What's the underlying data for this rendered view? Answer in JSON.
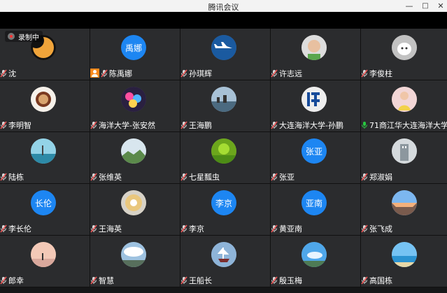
{
  "window": {
    "title": "腾讯会议",
    "minimize": "—",
    "maximize": "□",
    "close": "✕"
  },
  "recording": {
    "label": "录制中"
  },
  "participants": [
    {
      "name": "沈",
      "avatar_type": "image",
      "avatar_desc": "orange-moon",
      "mic": "muted"
    },
    {
      "name": "陈禹娜",
      "avatar_type": "text",
      "avatar_text": "禹娜",
      "mic": "muted",
      "role_icon": "host-person-icon"
    },
    {
      "name": "孙琪辉",
      "avatar_type": "image",
      "avatar_desc": "airplane",
      "mic": "muted"
    },
    {
      "name": "许志远",
      "avatar_type": "image",
      "avatar_desc": "child",
      "mic": "muted"
    },
    {
      "name": "李俊柱",
      "avatar_type": "image",
      "avatar_desc": "white-dog",
      "mic": "muted"
    },
    {
      "name": "李明智",
      "avatar_type": "image",
      "avatar_desc": "coffee",
      "mic": "muted"
    },
    {
      "name": "海洋大学-张安然",
      "avatar_type": "image",
      "avatar_desc": "colorful-group",
      "mic": "muted"
    },
    {
      "name": "王海鹏",
      "avatar_type": "image",
      "avatar_desc": "city-skyline",
      "mic": "muted"
    },
    {
      "name": "大连海洋大学-孙鹏",
      "avatar_type": "image",
      "avatar_desc": "calligraphy",
      "mic": "muted"
    },
    {
      "name": "71商江华大连海洋大学",
      "avatar_type": "image",
      "avatar_desc": "woman-yellow",
      "mic": "active"
    },
    {
      "name": "陆栋",
      "avatar_type": "image",
      "avatar_desc": "lake",
      "mic": "muted"
    },
    {
      "name": "张维英",
      "avatar_type": "image",
      "avatar_desc": "mountain-sky",
      "mic": "muted"
    },
    {
      "name": "七星瓢虫",
      "avatar_type": "image",
      "avatar_desc": "green-field",
      "mic": "muted"
    },
    {
      "name": "张亚",
      "avatar_type": "text",
      "avatar_text": "张亚",
      "mic": "muted"
    },
    {
      "name": "郑淑娟",
      "avatar_type": "image",
      "avatar_desc": "building",
      "mic": "muted"
    },
    {
      "name": "李长伦",
      "avatar_type": "text",
      "avatar_text": "长伦",
      "mic": "muted"
    },
    {
      "name": "王海英",
      "avatar_type": "image",
      "avatar_desc": "flower-bowl",
      "mic": "muted"
    },
    {
      "name": "李京",
      "avatar_type": "text",
      "avatar_text": "李京",
      "mic": "muted"
    },
    {
      "name": "黄亚南",
      "avatar_type": "text",
      "avatar_text": "亚南",
      "mic": "muted"
    },
    {
      "name": "张飞成",
      "avatar_type": "image",
      "avatar_desc": "sunset-road",
      "mic": "muted"
    },
    {
      "name": "郎幸",
      "avatar_type": "image",
      "avatar_desc": "person-sunset",
      "mic": "muted"
    },
    {
      "name": "智慧",
      "avatar_type": "image",
      "avatar_desc": "cloudy-sky",
      "mic": "muted"
    },
    {
      "name": "王船长",
      "avatar_type": "image",
      "avatar_desc": "tall-ship",
      "mic": "muted"
    },
    {
      "name": "殷玉梅",
      "avatar_type": "image",
      "avatar_desc": "blue-sky",
      "mic": "muted"
    },
    {
      "name": "高国栋",
      "avatar_type": "image",
      "avatar_desc": "ocean",
      "mic": "muted"
    }
  ],
  "colors": {
    "tile_bg": "#2b2c2e",
    "text_avatar_bg": "#1d86f2",
    "muted_mic": "#d8d8d8",
    "active_mic": "#28c840"
  }
}
